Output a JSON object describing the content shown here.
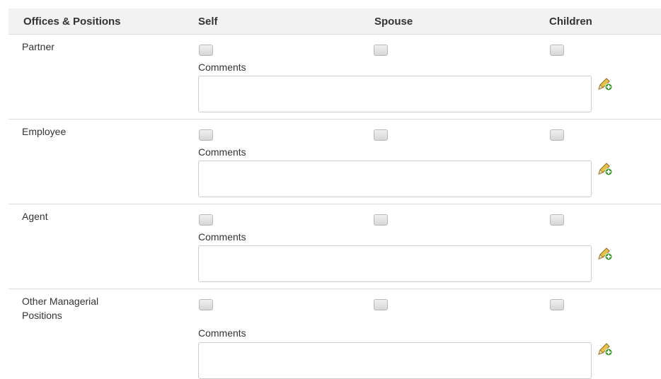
{
  "table": {
    "headers": {
      "offices_positions": "Offices & Positions",
      "self": "Self",
      "spouse": "Spouse",
      "children": "Children"
    },
    "rows": [
      {
        "label": "Partner",
        "comments_label": "Comments",
        "comments_value": "",
        "self": false,
        "spouse": false,
        "children": false
      },
      {
        "label": "Employee",
        "comments_label": "Comments",
        "comments_value": "",
        "self": false,
        "spouse": false,
        "children": false
      },
      {
        "label": "Agent",
        "comments_label": "Comments",
        "comments_value": "",
        "self": false,
        "spouse": false,
        "children": false
      },
      {
        "label": "Other Managerial Positions",
        "comments_label": "Comments",
        "comments_value": "",
        "self": false,
        "spouse": false,
        "children": false
      }
    ]
  },
  "icons": {
    "add_comment": "pencil-add-icon"
  }
}
